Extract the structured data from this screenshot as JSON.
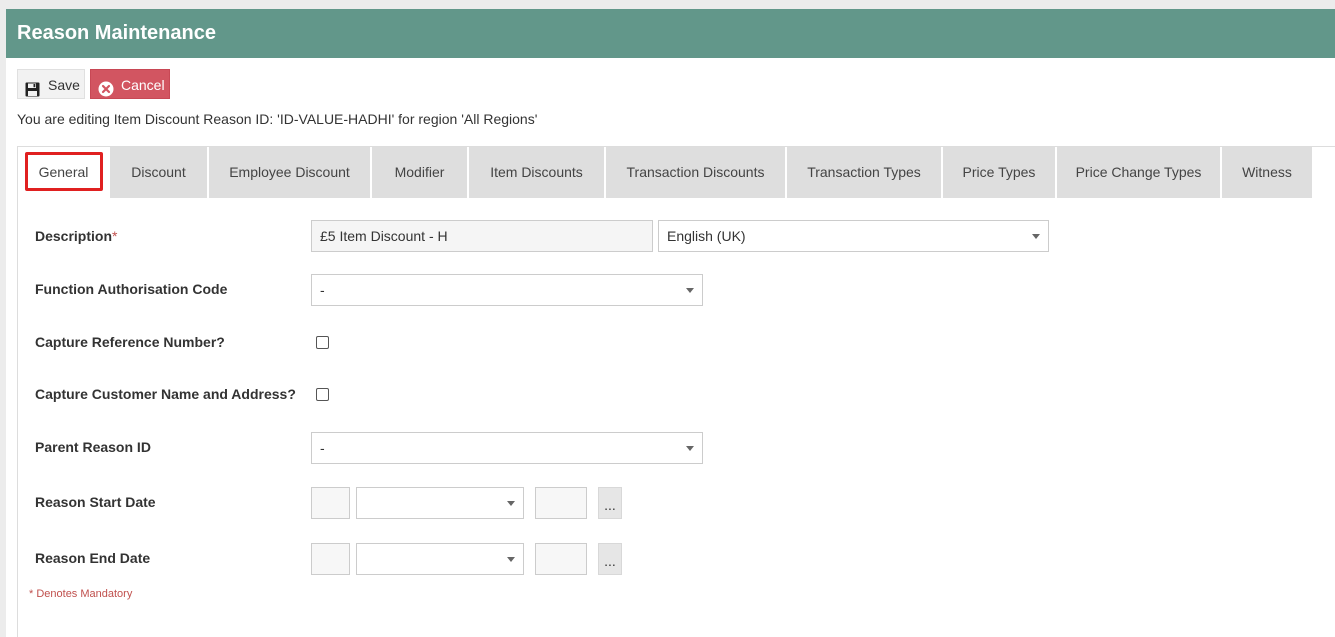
{
  "header": {
    "title": "Reason Maintenance"
  },
  "toolbar": {
    "save_label": "Save",
    "cancel_label": "Cancel"
  },
  "edit_info": "You are editing Item Discount Reason ID: 'ID-VALUE-HADHI' for region 'All Regions'",
  "tabs": [
    {
      "label": "General",
      "active": true
    },
    {
      "label": "Discount"
    },
    {
      "label": "Employee Discount"
    },
    {
      "label": "Modifier"
    },
    {
      "label": "Item Discounts"
    },
    {
      "label": "Transaction Discounts"
    },
    {
      "label": "Transaction Types"
    },
    {
      "label": "Price Types"
    },
    {
      "label": "Price Change Types"
    },
    {
      "label": "Witness"
    }
  ],
  "form": {
    "description": {
      "label": "Description",
      "required_mark": "*",
      "value": "£5 Item Discount - H",
      "language": "English (UK)"
    },
    "function_auth_code": {
      "label": "Function Authorisation Code",
      "value": "-"
    },
    "capture_reference": {
      "label": "Capture Reference Number?",
      "checked": false
    },
    "capture_customer": {
      "label": "Capture Customer Name and Address?",
      "checked": false
    },
    "parent_reason": {
      "label": "Parent Reason ID",
      "value": "-"
    },
    "start_date": {
      "label": "Reason Start Date",
      "picker_label": "..."
    },
    "end_date": {
      "label": "Reason End Date",
      "picker_label": "..."
    }
  },
  "mandatory_note": "* Denotes Mandatory",
  "colors": {
    "header": "#62978a",
    "cancel": "#d25561",
    "highlight": "#e02020"
  },
  "icons": {
    "save": "floppy-disk-icon",
    "cancel": "close-circle-icon",
    "dropdown": "caret-down-icon"
  }
}
